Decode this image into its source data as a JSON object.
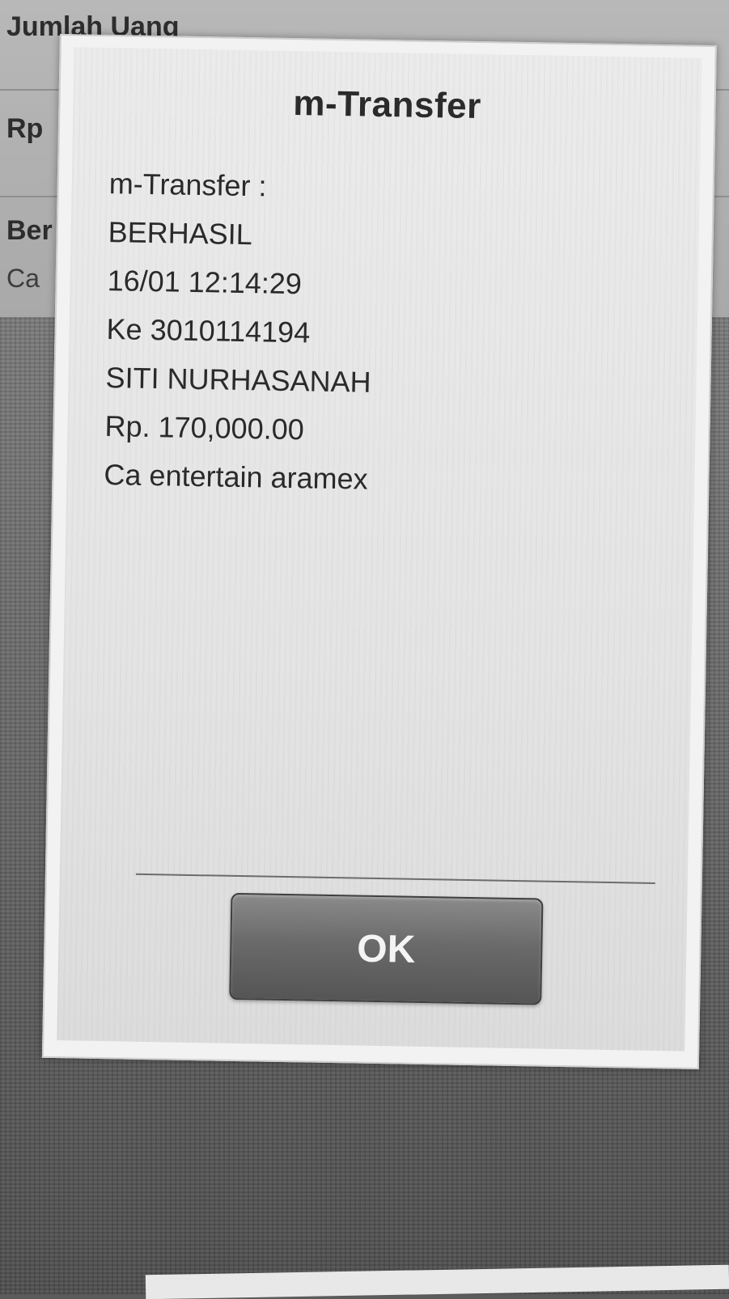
{
  "background": {
    "amount_label": "Jumlah Uang",
    "currency_label": "Rp",
    "note_label": "Ber",
    "note_value": "Ca"
  },
  "dialog": {
    "title": "m-Transfer",
    "message_lines": [
      "m-Transfer :",
      "BERHASIL",
      "16/01 12:14:29",
      "Ke 3010114194",
      "SITI NURHASANAH",
      "Rp. 170,000.00",
      "Ca entertain aramex"
    ],
    "ok_label": "OK"
  }
}
